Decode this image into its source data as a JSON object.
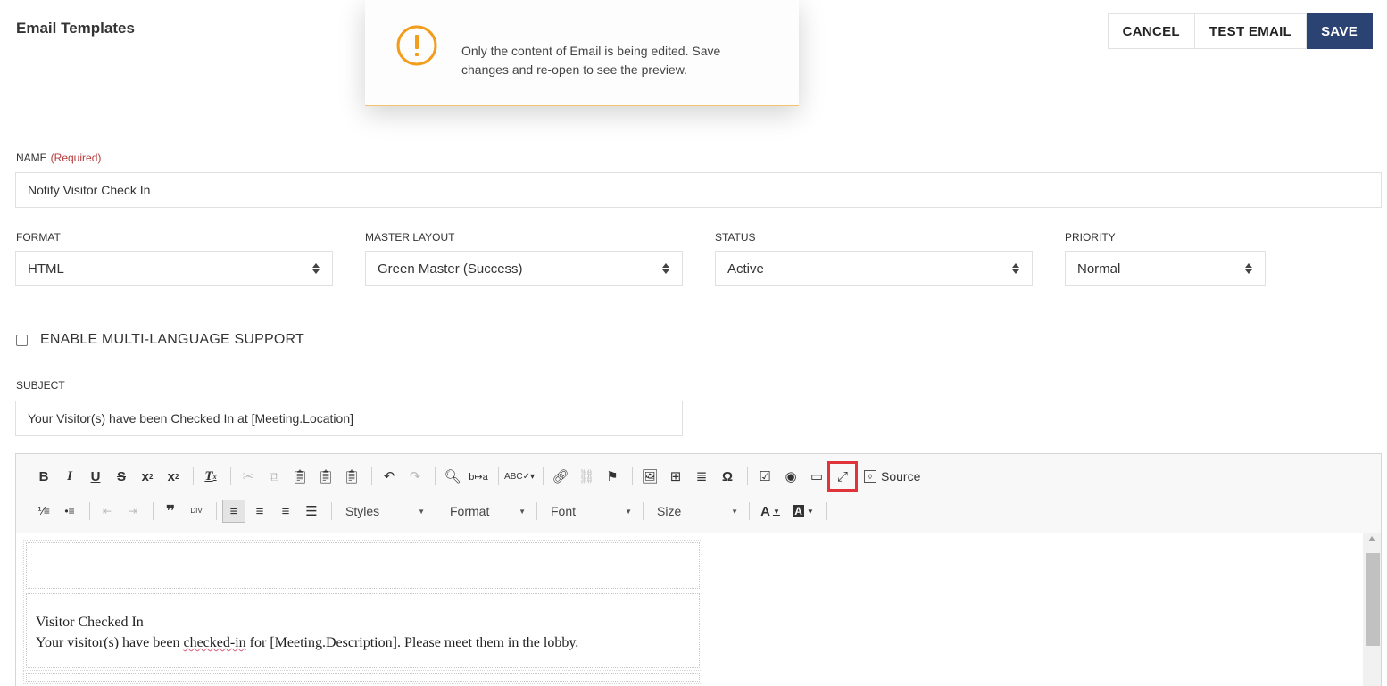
{
  "page": {
    "title": "Email Templates"
  },
  "actions": {
    "cancel": "CANCEL",
    "test_email": "TEST EMAIL",
    "save": "SAVE"
  },
  "colors": {
    "primary": "#2b4372",
    "warning": "#f29d1b",
    "required": "#b53a3a",
    "highlight": "#e0333a"
  },
  "toast": {
    "icon": "warning-circle-icon",
    "message": "Only the content of Email is being edited. Save changes and re-open to see the preview."
  },
  "form": {
    "name": {
      "label": "NAME",
      "required": "(Required)",
      "value": "Notify Visitor Check In"
    },
    "format": {
      "label": "FORMAT",
      "value": "HTML"
    },
    "master_layout": {
      "label": "MASTER LAYOUT",
      "value": "Green Master (Success)"
    },
    "status": {
      "label": "STATUS",
      "value": "Active"
    },
    "priority": {
      "label": "PRIORITY",
      "value": "Normal"
    },
    "multilang": {
      "label": "ENABLE MULTI-LANGUAGE SUPPORT",
      "checked": false
    },
    "subject": {
      "label": "SUBJECT",
      "value": "Your Visitor(s) have been Checked In at [Meeting.Location]"
    }
  },
  "editor": {
    "toolbar": {
      "source_label": "Source",
      "styles_label": "Styles",
      "format_label": "Format",
      "font_label": "Font",
      "size_label": "Size"
    },
    "content": {
      "heading": "Visitor Checked In",
      "body_pre": "Your visitor(s) have been ",
      "body_spell": "checked-in",
      "body_post": " for [Meeting.Description]. Please meet them in the lobby."
    }
  }
}
